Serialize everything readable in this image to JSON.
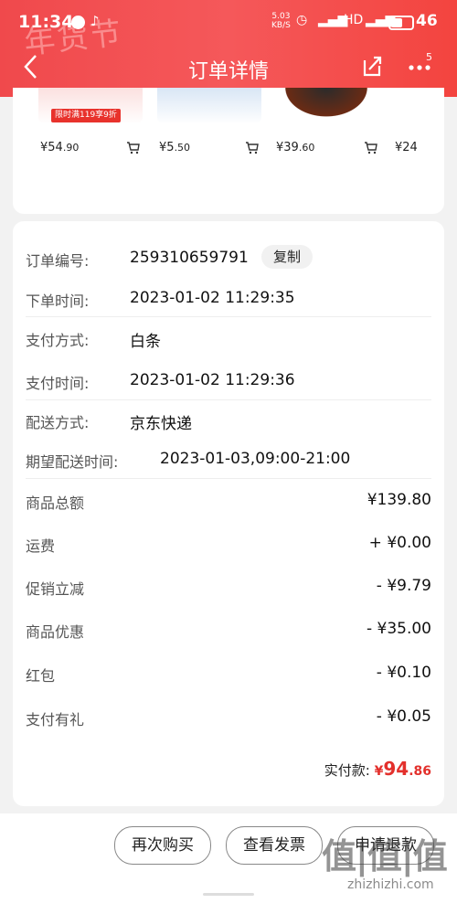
{
  "status_bar": {
    "time": "11:34",
    "net_speed_value": "5.03",
    "net_speed_unit": "KB/S",
    "battery_level": "46"
  },
  "header": {
    "decoration_text": "年货节",
    "title": "订单详情",
    "more_badge": "5",
    "background_color": "#f0494c"
  },
  "products": [
    {
      "price_symbol": "¥",
      "price_int": "54",
      "price_dec": ".90",
      "promo": "限时满119享9折"
    },
    {
      "price_symbol": "¥",
      "price_int": "5",
      "price_dec": ".50"
    },
    {
      "price_symbol": "¥",
      "price_int": "39",
      "price_dec": ".60"
    },
    {
      "price_symbol": "¥",
      "price_int": "24",
      "price_dec": ""
    }
  ],
  "order_info": {
    "order_no_label": "订单编号:",
    "order_no": "259310659791",
    "copy_label": "复制",
    "order_time_label": "下单时间:",
    "order_time": "2023-01-02 11:29:35",
    "pay_method_label": "支付方式:",
    "pay_method": "白条",
    "pay_time_label": "支付时间:",
    "pay_time": "2023-01-02 11:29:36",
    "delivery_label": "配送方式:",
    "delivery": "京东快递",
    "expected_label": "期望配送时间:",
    "expected": "2023-01-03,09:00-21:00"
  },
  "amounts": [
    {
      "label": "商品总额",
      "value": "¥139.80"
    },
    {
      "label": "运费",
      "value": "+ ¥0.00"
    },
    {
      "label": "促销立减",
      "value": "- ¥9.79"
    },
    {
      "label": "商品优惠",
      "value": "- ¥35.00"
    },
    {
      "label": "红包",
      "value": "- ¥0.10"
    },
    {
      "label": "支付有礼",
      "value": "- ¥0.05"
    }
  ],
  "paid": {
    "label": "实付款:",
    "symbol": "¥",
    "integer": "94",
    "decimal": ".86",
    "color": "#e3302c"
  },
  "bottom_buttons": {
    "rebuy": "再次购买",
    "invoice": "查看发票",
    "refund": "申请退款"
  },
  "watermark": {
    "main": "值|值|值",
    "sub": "zhizhizhi.com"
  }
}
